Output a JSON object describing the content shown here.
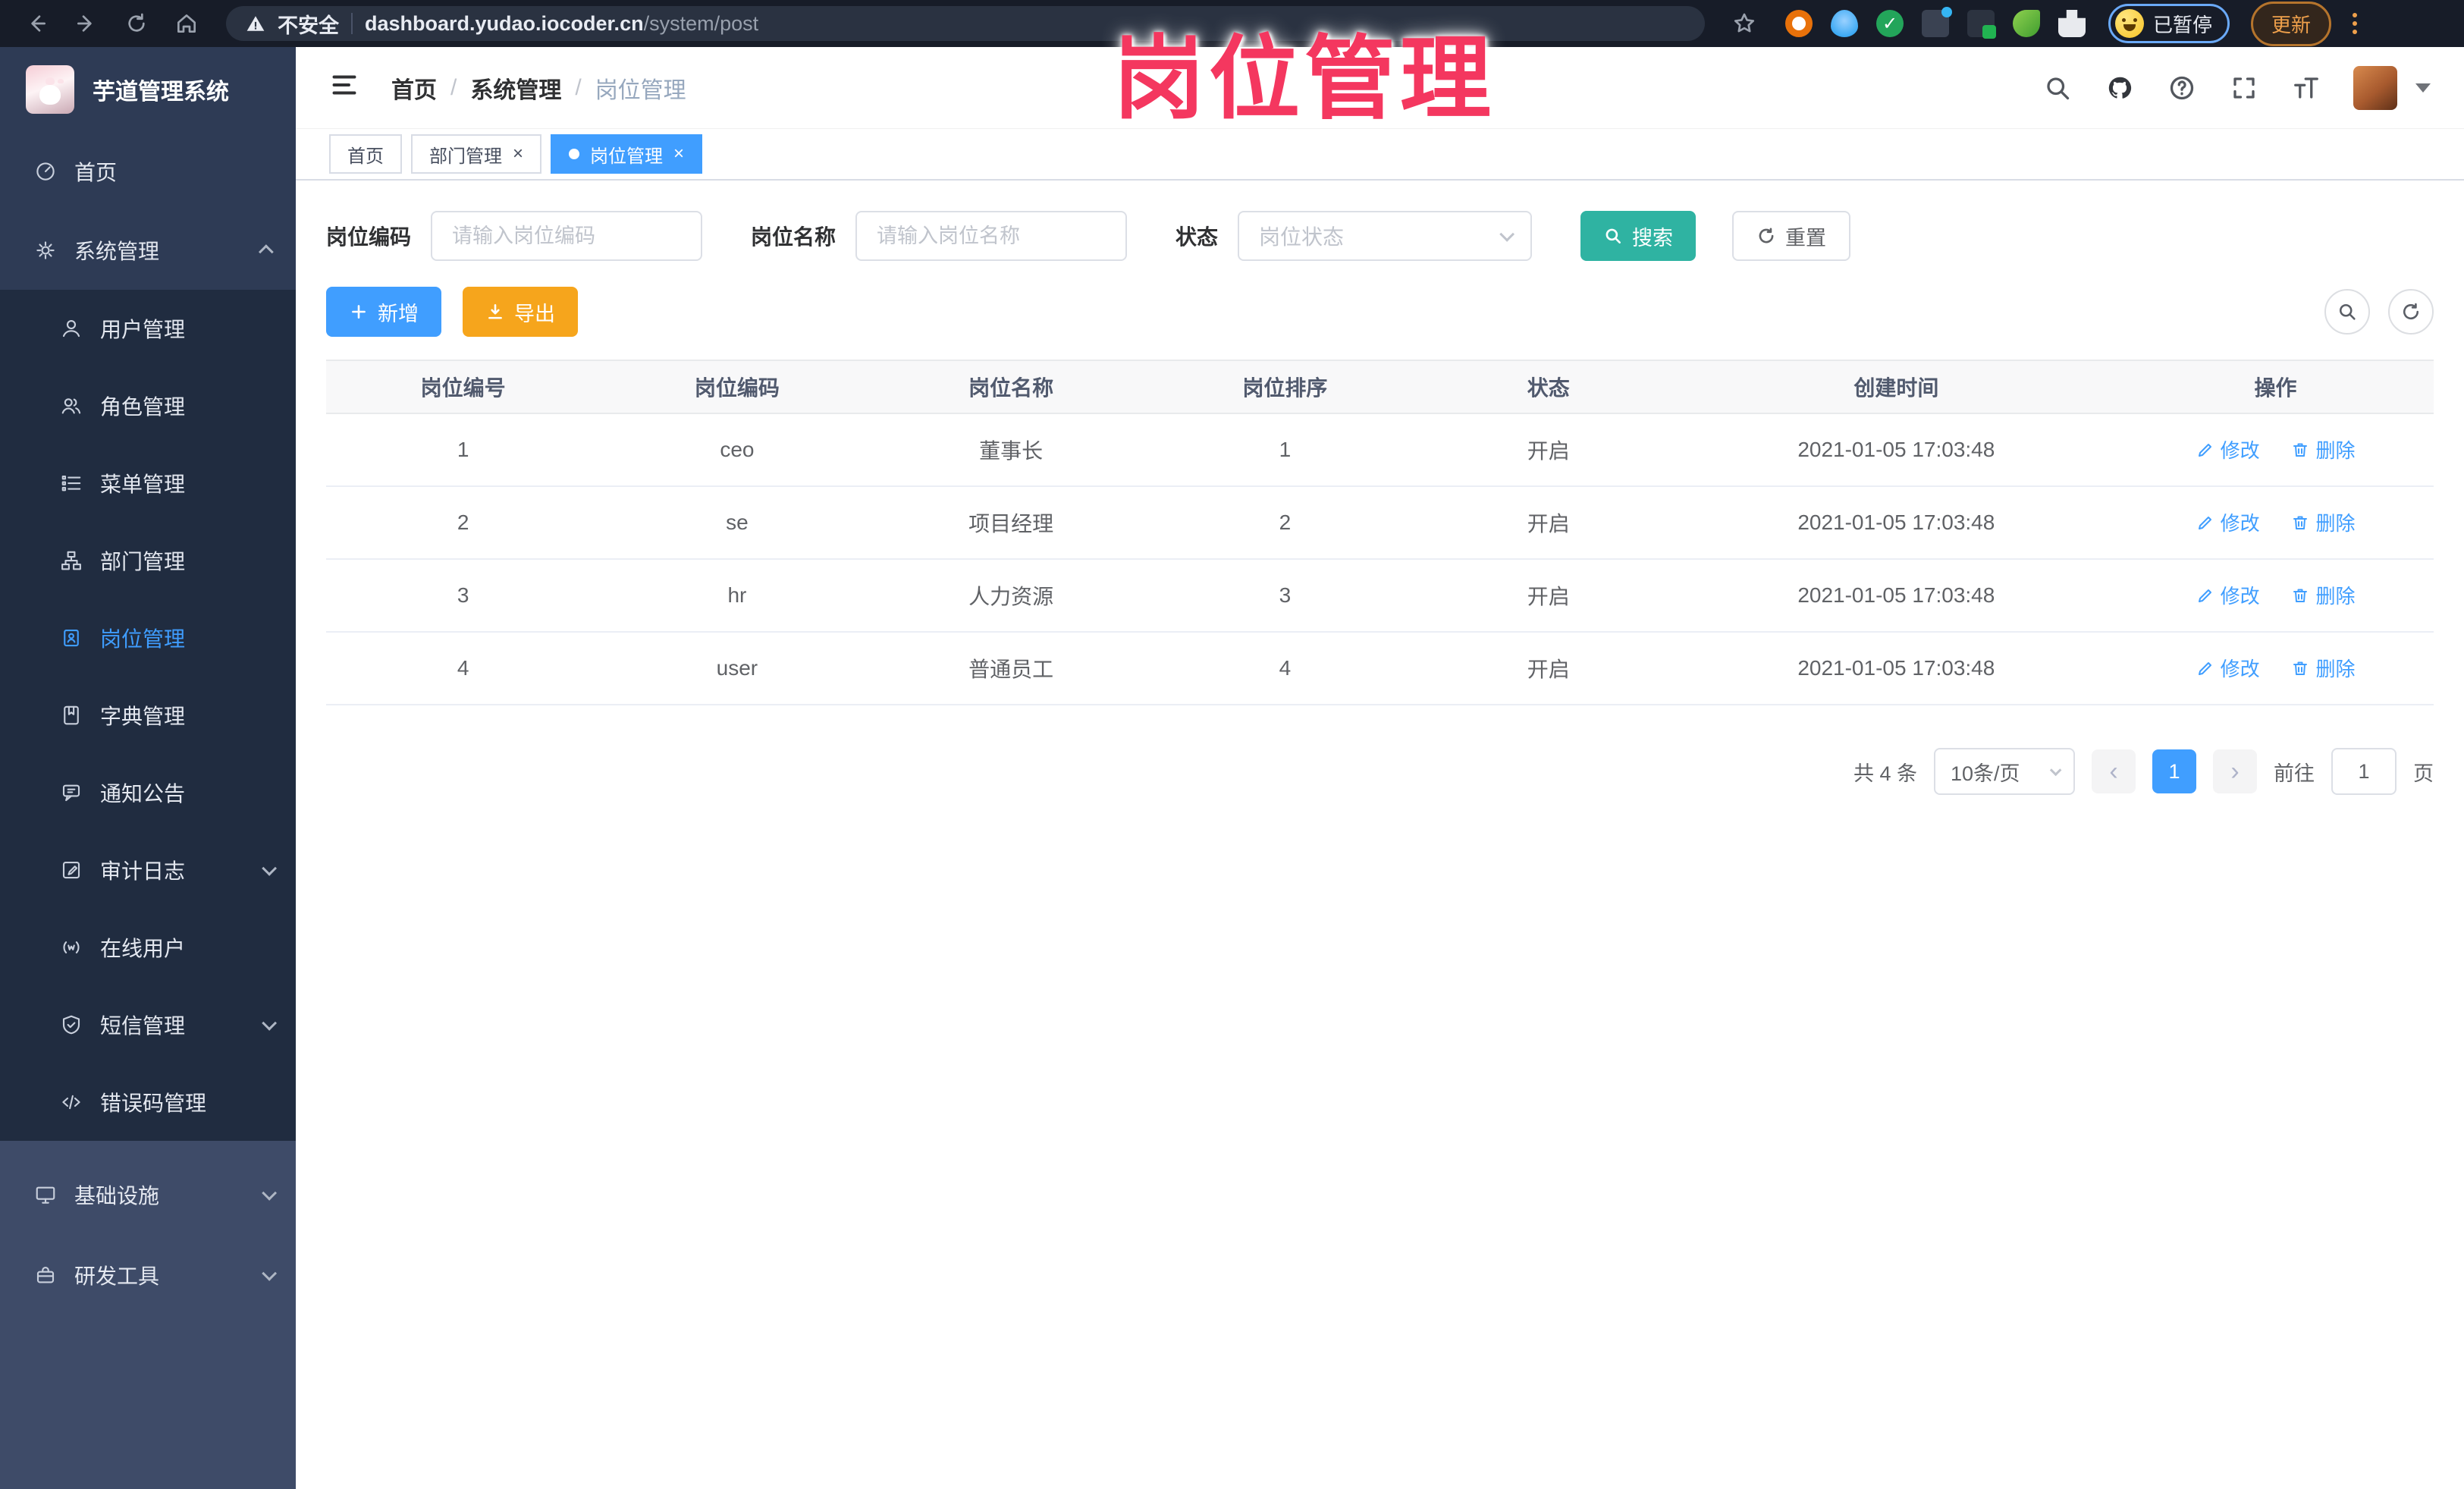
{
  "overlay": {
    "title": "岗位管理"
  },
  "ui": {
    "close_glyph": "×",
    "breadcrumb_separator": "/",
    "prev_glyph": "‹",
    "next_glyph": "›",
    "check_glyph": "✓"
  },
  "colors": {
    "accent": "#409eff",
    "search_teal": "#2fb3a2",
    "export_orange": "#f6a51c",
    "overlay_pink": "#f4375f",
    "active_tab": "#409eff"
  },
  "browser": {
    "security_label": "不安全",
    "url_host": "dashboard.yudao.iocoder.cn",
    "url_path": "/system/post",
    "paused_badge": "已暂停",
    "update_button": "更新"
  },
  "sidebar": {
    "app_title": "芋道管理系统",
    "root_items": [
      {
        "label": "首页",
        "icon": "dashboard-icon"
      },
      {
        "label": "系统管理",
        "icon": "gear-icon",
        "state": "expanded"
      }
    ],
    "system_submenu": [
      {
        "label": "用户管理",
        "icon": "user-icon"
      },
      {
        "label": "角色管理",
        "icon": "role-icon"
      },
      {
        "label": "菜单管理",
        "icon": "menu-list-icon"
      },
      {
        "label": "部门管理",
        "icon": "org-tree-icon"
      },
      {
        "label": "岗位管理",
        "icon": "post-badge-icon",
        "active": true
      },
      {
        "label": "字典管理",
        "icon": "dict-book-icon"
      },
      {
        "label": "通知公告",
        "icon": "notice-icon"
      },
      {
        "label": "审计日志",
        "icon": "audit-log-icon",
        "state": "collapsed"
      },
      {
        "label": "在线用户",
        "icon": "online-user-icon"
      },
      {
        "label": "短信管理",
        "icon": "sms-shield-icon",
        "state": "collapsed"
      },
      {
        "label": "错误码管理",
        "icon": "error-code-icon"
      }
    ],
    "bottom_items": [
      {
        "label": "基础设施",
        "icon": "infra-icon",
        "state": "collapsed"
      },
      {
        "label": "研发工具",
        "icon": "devtools-icon",
        "state": "collapsed"
      }
    ]
  },
  "header": {
    "breadcrumb": [
      "首页",
      "系统管理",
      "岗位管理"
    ]
  },
  "tabs": [
    {
      "label": "首页"
    },
    {
      "label": "部门管理",
      "closable": true
    },
    {
      "label": "岗位管理",
      "closable": true,
      "active": true
    }
  ],
  "filters": {
    "code_label": "岗位编码",
    "code_placeholder": "请输入岗位编码",
    "name_label": "岗位名称",
    "name_placeholder": "请输入岗位名称",
    "status_label": "状态",
    "status_placeholder": "岗位状态",
    "search_label": "搜索",
    "reset_label": "重置"
  },
  "toolbar": {
    "add_label": "新增",
    "export_label": "导出"
  },
  "table": {
    "columns": [
      "岗位编号",
      "岗位编码",
      "岗位名称",
      "岗位排序",
      "状态",
      "创建时间",
      "操作"
    ],
    "edit_label": "修改",
    "delete_label": "删除",
    "rows": [
      {
        "id": "1",
        "code": "ceo",
        "name": "董事长",
        "sort": "1",
        "status": "开启",
        "created": "2021-01-05 17:03:48"
      },
      {
        "id": "2",
        "code": "se",
        "name": "项目经理",
        "sort": "2",
        "status": "开启",
        "created": "2021-01-05 17:03:48"
      },
      {
        "id": "3",
        "code": "hr",
        "name": "人力资源",
        "sort": "3",
        "status": "开启",
        "created": "2021-01-05 17:03:48"
      },
      {
        "id": "4",
        "code": "user",
        "name": "普通员工",
        "sort": "4",
        "status": "开启",
        "created": "2021-01-05 17:03:48"
      }
    ]
  },
  "pagination": {
    "total": "共 4 条",
    "page_size": "10条/页",
    "current_page": "1",
    "jump_prefix": "前往",
    "jump_value": "1",
    "jump_suffix": "页"
  }
}
